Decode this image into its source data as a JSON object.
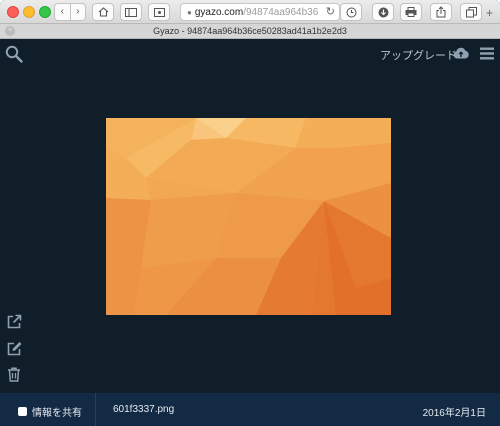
{
  "browser": {
    "url_host": "gyazo.com",
    "url_path": "/94874aa964b36",
    "tab_title": "Gyazo - 94874aa964b36ce50283ad41a1b2e2d3",
    "icons": {
      "back": "chevron-left-icon",
      "forward": "chevron-right-icon",
      "home": "home-icon",
      "sidebar": "sidebar-icon",
      "reload": "reload-icon",
      "history": "history-icon",
      "download": "download-icon",
      "print": "print-icon",
      "share": "share-icon",
      "tabs": "tabs-icon",
      "new_tab": "plus-icon"
    }
  },
  "header": {
    "upgrade_label": "アップグレード",
    "icons": {
      "search": "search-icon",
      "upload": "cloud-upload-icon",
      "menu": "menu-icon"
    }
  },
  "sidebar": {
    "icons": {
      "open": "external-link-icon",
      "edit": "edit-icon",
      "delete": "trash-icon"
    }
  },
  "footer": {
    "share_label": "情報を共有",
    "filename": "601f3337.png",
    "date": "2016年2月1日"
  },
  "colors": {
    "background": "#101e2a",
    "footer": "#122a43",
    "image_base": "#f2a24f",
    "image_dark": "#e4742f",
    "image_light": "#fbd08a"
  }
}
